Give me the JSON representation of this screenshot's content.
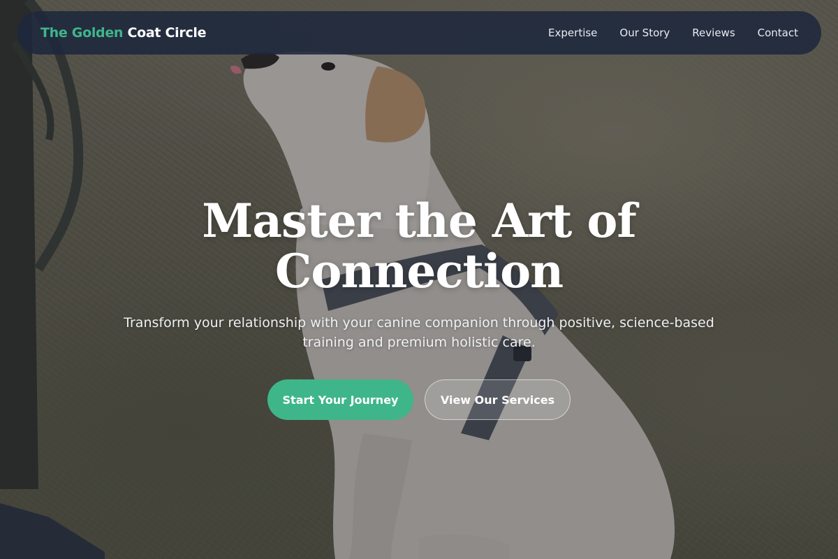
{
  "nav": {
    "brand_accent": "The Golden",
    "brand_rest": "Coat Circle",
    "links": [
      {
        "label": "Expertise"
      },
      {
        "label": "Our Story"
      },
      {
        "label": "Reviews"
      },
      {
        "label": "Contact"
      }
    ]
  },
  "hero": {
    "title_line1": "Master the Art of",
    "title_line2": "Connection",
    "subtitle_line1": "Transform your relationship with your canine companion through positive, science-based",
    "subtitle_line2": "training and premium holistic care.",
    "primary_button": "Start Your Journey",
    "secondary_button": "View Our Services"
  },
  "colors": {
    "accent": "#3fb68a",
    "nav_background": "#1e283c",
    "text": "#ffffff"
  },
  "background_image": "labrador-sitting-on-grass-photo"
}
